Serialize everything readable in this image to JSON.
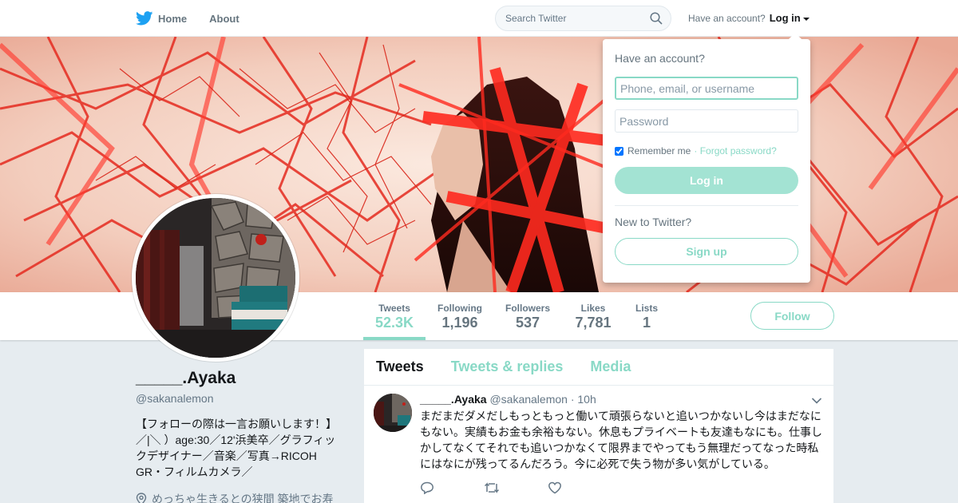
{
  "nav": {
    "home_label": "Home",
    "about_label": "About",
    "search_placeholder": "Search Twitter",
    "have_account": "Have an account?",
    "login_label": "Log in"
  },
  "profile": {
    "display_name": "_____.Ayaka",
    "handle": "@sakanalemon",
    "bio": "【フォローの際は一言お願いします！】／|＼ ）age:30／12'浜美卒／グラフィックデザイナー／音楽／写真→RICOH GR・フィルムカメラ／",
    "location": "めっちゃ生きるとの狭間 築地でお寿"
  },
  "stats": [
    {
      "label": "Tweets",
      "value": "52.3K"
    },
    {
      "label": "Following",
      "value": "1,196"
    },
    {
      "label": "Followers",
      "value": "537"
    },
    {
      "label": "Likes",
      "value": "7,781"
    },
    {
      "label": "Lists",
      "value": "1"
    }
  ],
  "follow_label": "Follow",
  "tabs": [
    {
      "label": "Tweets"
    },
    {
      "label": "Tweets & replies"
    },
    {
      "label": "Media"
    }
  ],
  "tweet": {
    "name": "_____.Ayaka",
    "handle": "@sakanalemon",
    "time": "· 10h",
    "text": "まだまだダメだしもっともっと働いて頑張らないと追いつかないし今はまだなにもない。実績もお金も余裕もない。休息もプライベートも友達もなにも。仕事しかしてなくてそれでも追いつかなくて限界までやってもう無理だってなった時私にはなにが残ってるんだろう。今に必死で失う物が多い気がしている。"
  },
  "login_dropdown": {
    "heading": "Have an account?",
    "username_placeholder": "Phone, email, or username",
    "password_placeholder": "Password",
    "remember_label": "Remember me",
    "forgot_label": "· Forgot password?",
    "login_button": "Log in",
    "new_label": "New to Twitter?",
    "signup_button": "Sign up"
  },
  "colors": {
    "accent": "#89d9c6",
    "twitter_blue": "#1da1f2",
    "banner_red": "#e8281e"
  },
  "icons": [
    "twitter-bird-icon",
    "search-icon",
    "location-pin-icon",
    "chevron-down-icon",
    "reply-icon",
    "retweet-icon",
    "like-icon"
  ]
}
